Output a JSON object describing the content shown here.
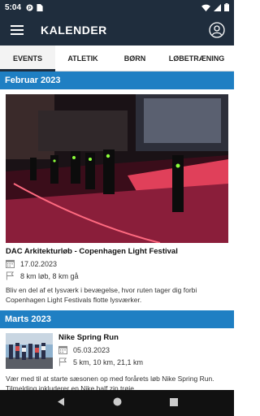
{
  "status": {
    "time": "5:04"
  },
  "appbar": {
    "title": "KALENDER"
  },
  "tabs": [
    {
      "label": "EVENTS",
      "active": true
    },
    {
      "label": "ATLETIK",
      "active": false
    },
    {
      "label": "BØRN",
      "active": false
    },
    {
      "label": "LØBETRÆNING",
      "active": false
    }
  ],
  "months": [
    {
      "label": "Februar 2023",
      "event": {
        "title": "DAC Arkitekturløb - Copenhagen Light Festival",
        "date": "17.02.2023",
        "distances": "8 km løb, 8 km gå",
        "description": "Bliv en del af et lysværk i bevægelse, hvor ruten tager dig forbi Copenhagen Light Festivals flotte lysværker."
      }
    },
    {
      "label": "Marts 2023",
      "event": {
        "title": "Nike Spring Run",
        "date": "05.03.2023",
        "distances": "5 km, 10 km, 21,1 km",
        "description": "Vær med til at starte sæsonen op med forårets løb Nike Spring Run. Tilmelding inkluderer en Nike half zip trøje."
      }
    }
  ],
  "colors": {
    "appbar": "#1f2d3d",
    "month_header": "#1f7fc3"
  }
}
